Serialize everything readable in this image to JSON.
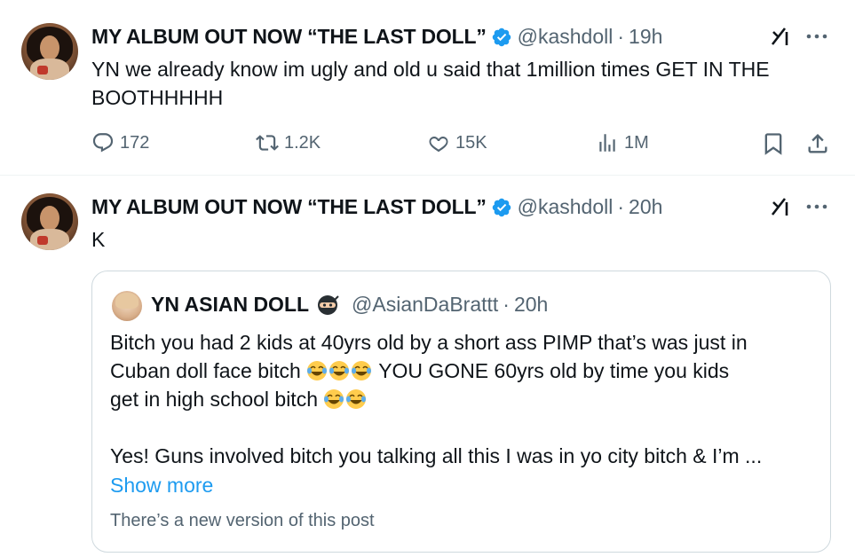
{
  "tweets": [
    {
      "display_name": "MY ALBUM OUT NOW “THE LAST DOLL”",
      "handle": "@kashdoll",
      "separator": "·",
      "time": "19h",
      "text_line1": "YN we already know im ugly and old u said that 1million times GET IN THE",
      "text_line2": "BOOTHHHHH",
      "replies": "172",
      "reposts": "1.2K",
      "likes": "15K",
      "views": "1M"
    },
    {
      "display_name": "MY ALBUM OUT NOW “THE LAST DOLL”",
      "handle": "@kashdoll",
      "separator": "·",
      "time": "20h",
      "text": "K",
      "quote": {
        "display_name": "YN ASIAN DOLL",
        "handle": "@AsianDaBrattt",
        "separator": "·",
        "time": "20h",
        "line1": "Bitch you had 2 kids at 40yrs old by a short ass PIMP that’s was just in",
        "line2_a": "Cuban doll face bitch",
        "line2_b": "YOU GONE 60yrs old by time you kids",
        "line3": "get in high school bitch",
        "line4": "Yes! Guns involved bitch you talking all this I was in yo city bitch & I’m ...",
        "show_more": "Show more",
        "notice": "There’s a new version of this post"
      }
    }
  ],
  "icons": {
    "verified": "verified-badge-icon",
    "grok": "grok-icon",
    "more": "more-icon",
    "reply": "reply-icon",
    "repost": "repost-icon",
    "like": "heart-icon",
    "views": "views-icon",
    "bookmark": "bookmark-icon",
    "share": "share-icon",
    "ninja": "ninja-emoji",
    "laugh": "tears-of-joy-emoji"
  },
  "colors": {
    "text": "#0f1419",
    "secondary": "#536471",
    "accent": "#1d9bf0",
    "border": "#cfd9de"
  }
}
